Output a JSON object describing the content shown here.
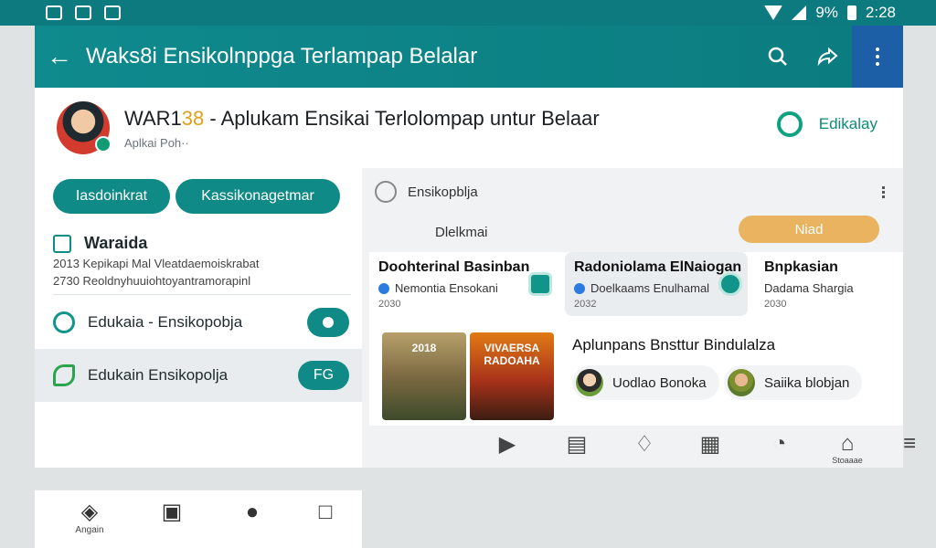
{
  "status_bar": {
    "battery_text": "9%",
    "time": "2:28",
    "icons": [
      "notification-icon",
      "notification-icon",
      "notification-icon",
      "wifi-icon",
      "signal-icon",
      "battery-icon"
    ]
  },
  "app_bar": {
    "title": "Waks8i Ensikolnppga Terlampap Belalar",
    "icons": [
      "back-arrow-icon",
      "search-icon",
      "share-icon",
      "more-vertical-icon"
    ]
  },
  "header": {
    "title_prefix": "WAR1",
    "title_number": "38",
    "title_rest": " - Aplukam Ensikai Terlolompap untur Belaar",
    "subtitle": "Aplkai Poh··",
    "brand_label": "Edikalay"
  },
  "left_panel": {
    "pills": [
      "Iasdoinkrat",
      "Kassikonagetmar"
    ],
    "featured": {
      "title": "Waraida",
      "lines": [
        "Kepikapi Mal Vleatdaemoiskrabat",
        "Reoldnyhuuiohtoyantramorapinl"
      ],
      "line_prefixes": [
        "2013",
        "2730"
      ]
    },
    "items": [
      {
        "label": "Edukaia - Ensikopobja",
        "button": ""
      },
      {
        "label": "Edukain Ensikopolja",
        "button": "FG"
      }
    ],
    "nav": [
      {
        "icon": "diamond-icon",
        "label": "Angain"
      },
      {
        "icon": "tablet-icon",
        "label": ""
      },
      {
        "icon": "bell-icon",
        "label": ""
      },
      {
        "icon": "bookmark-icon",
        "label": ""
      }
    ]
  },
  "right_panel": {
    "header_label": "Ensikopblja",
    "filter_label": "Dlelkmai",
    "chip_label": "Niad",
    "cards": [
      {
        "title": "Doohterinal Basinban",
        "sub": "Nemontia Ensokani",
        "meta": "2030"
      },
      {
        "title": "Radoniolama ElNaiogan",
        "sub": "Doelkaams Enulhamal",
        "meta": "2032"
      },
      {
        "title": "Bnpkasian",
        "sub": "Dadama Shargia",
        "meta": "2030"
      }
    ],
    "posters": [
      {
        "text": "2018"
      },
      {
        "text": "VIVAERSA RADOAHA"
      }
    ],
    "lower_title": "Aplunpans Bnsttur Bindulalza",
    "people": [
      "Uodlao Bonoka",
      "Saiika blobjan"
    ],
    "nav_icons": [
      "play-icon",
      "book-icon",
      "shape-icon",
      "edit-icon",
      "chart-icon",
      "home-icon",
      "menu-icon"
    ],
    "nav_home_label": "Stoaaae"
  }
}
